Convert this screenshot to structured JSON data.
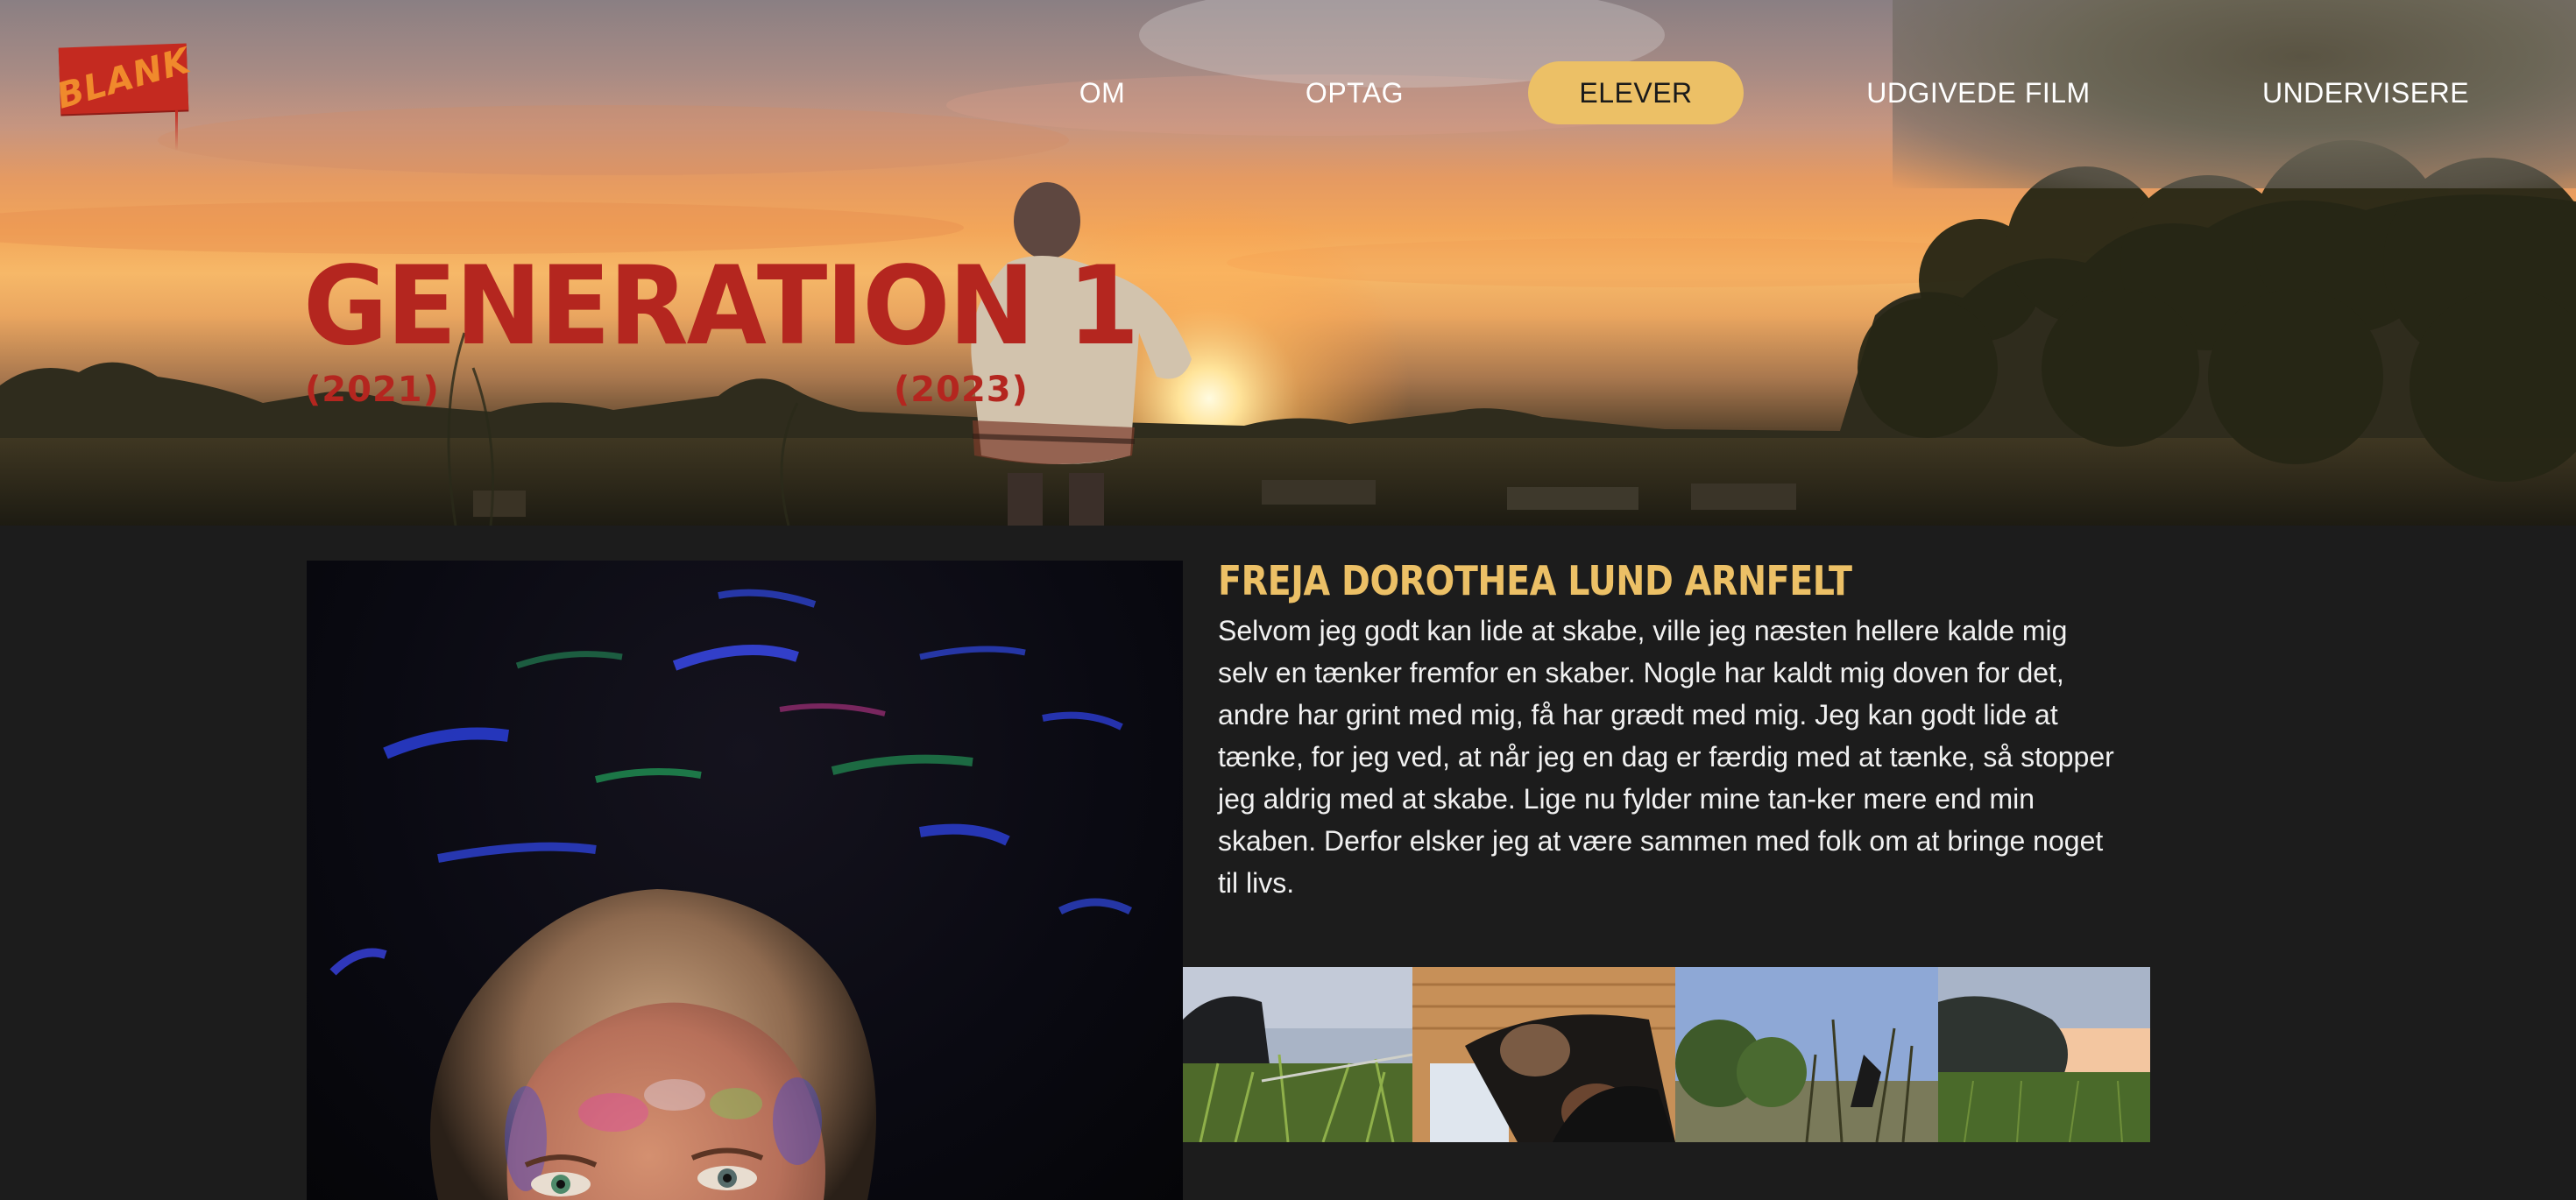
{
  "site": {
    "logo_text": "BLANK"
  },
  "nav": {
    "items": [
      {
        "label": "OM",
        "active": false
      },
      {
        "label": "OPTAG",
        "active": false
      },
      {
        "label": "ELEVER",
        "active": true
      },
      {
        "label": "UDGIVEDE FILM",
        "active": false
      },
      {
        "label": "UNDERVISERE",
        "active": false
      }
    ]
  },
  "hero": {
    "title": "GENERATION 1",
    "year_start": "(2021)",
    "year_end": "(2023)"
  },
  "student": {
    "name": "FREJA DOROTHEA LUND ARNFELT",
    "bio": "Selvom jeg godt kan lide at skabe, ville jeg næsten hellere kalde mig selv en tænker fremfor en skaber. Nogle har kaldt mig doven for det, andre har grint med mig, få har grædt med mig. Jeg kan godt lide at tænke, for jeg ved, at når jeg en dag er færdig med at tænke, så stopper jeg aldrig med at skabe. Lige nu fylder mine tan-ker mere end min skaben. Derfor elsker jeg at være sammen med folk om at bringe noget til livs."
  },
  "colors": {
    "accent_yellow": "#ecc066",
    "brand_red": "#b4261f",
    "background": "#1c1c1c",
    "text": "#f1f1f1"
  }
}
